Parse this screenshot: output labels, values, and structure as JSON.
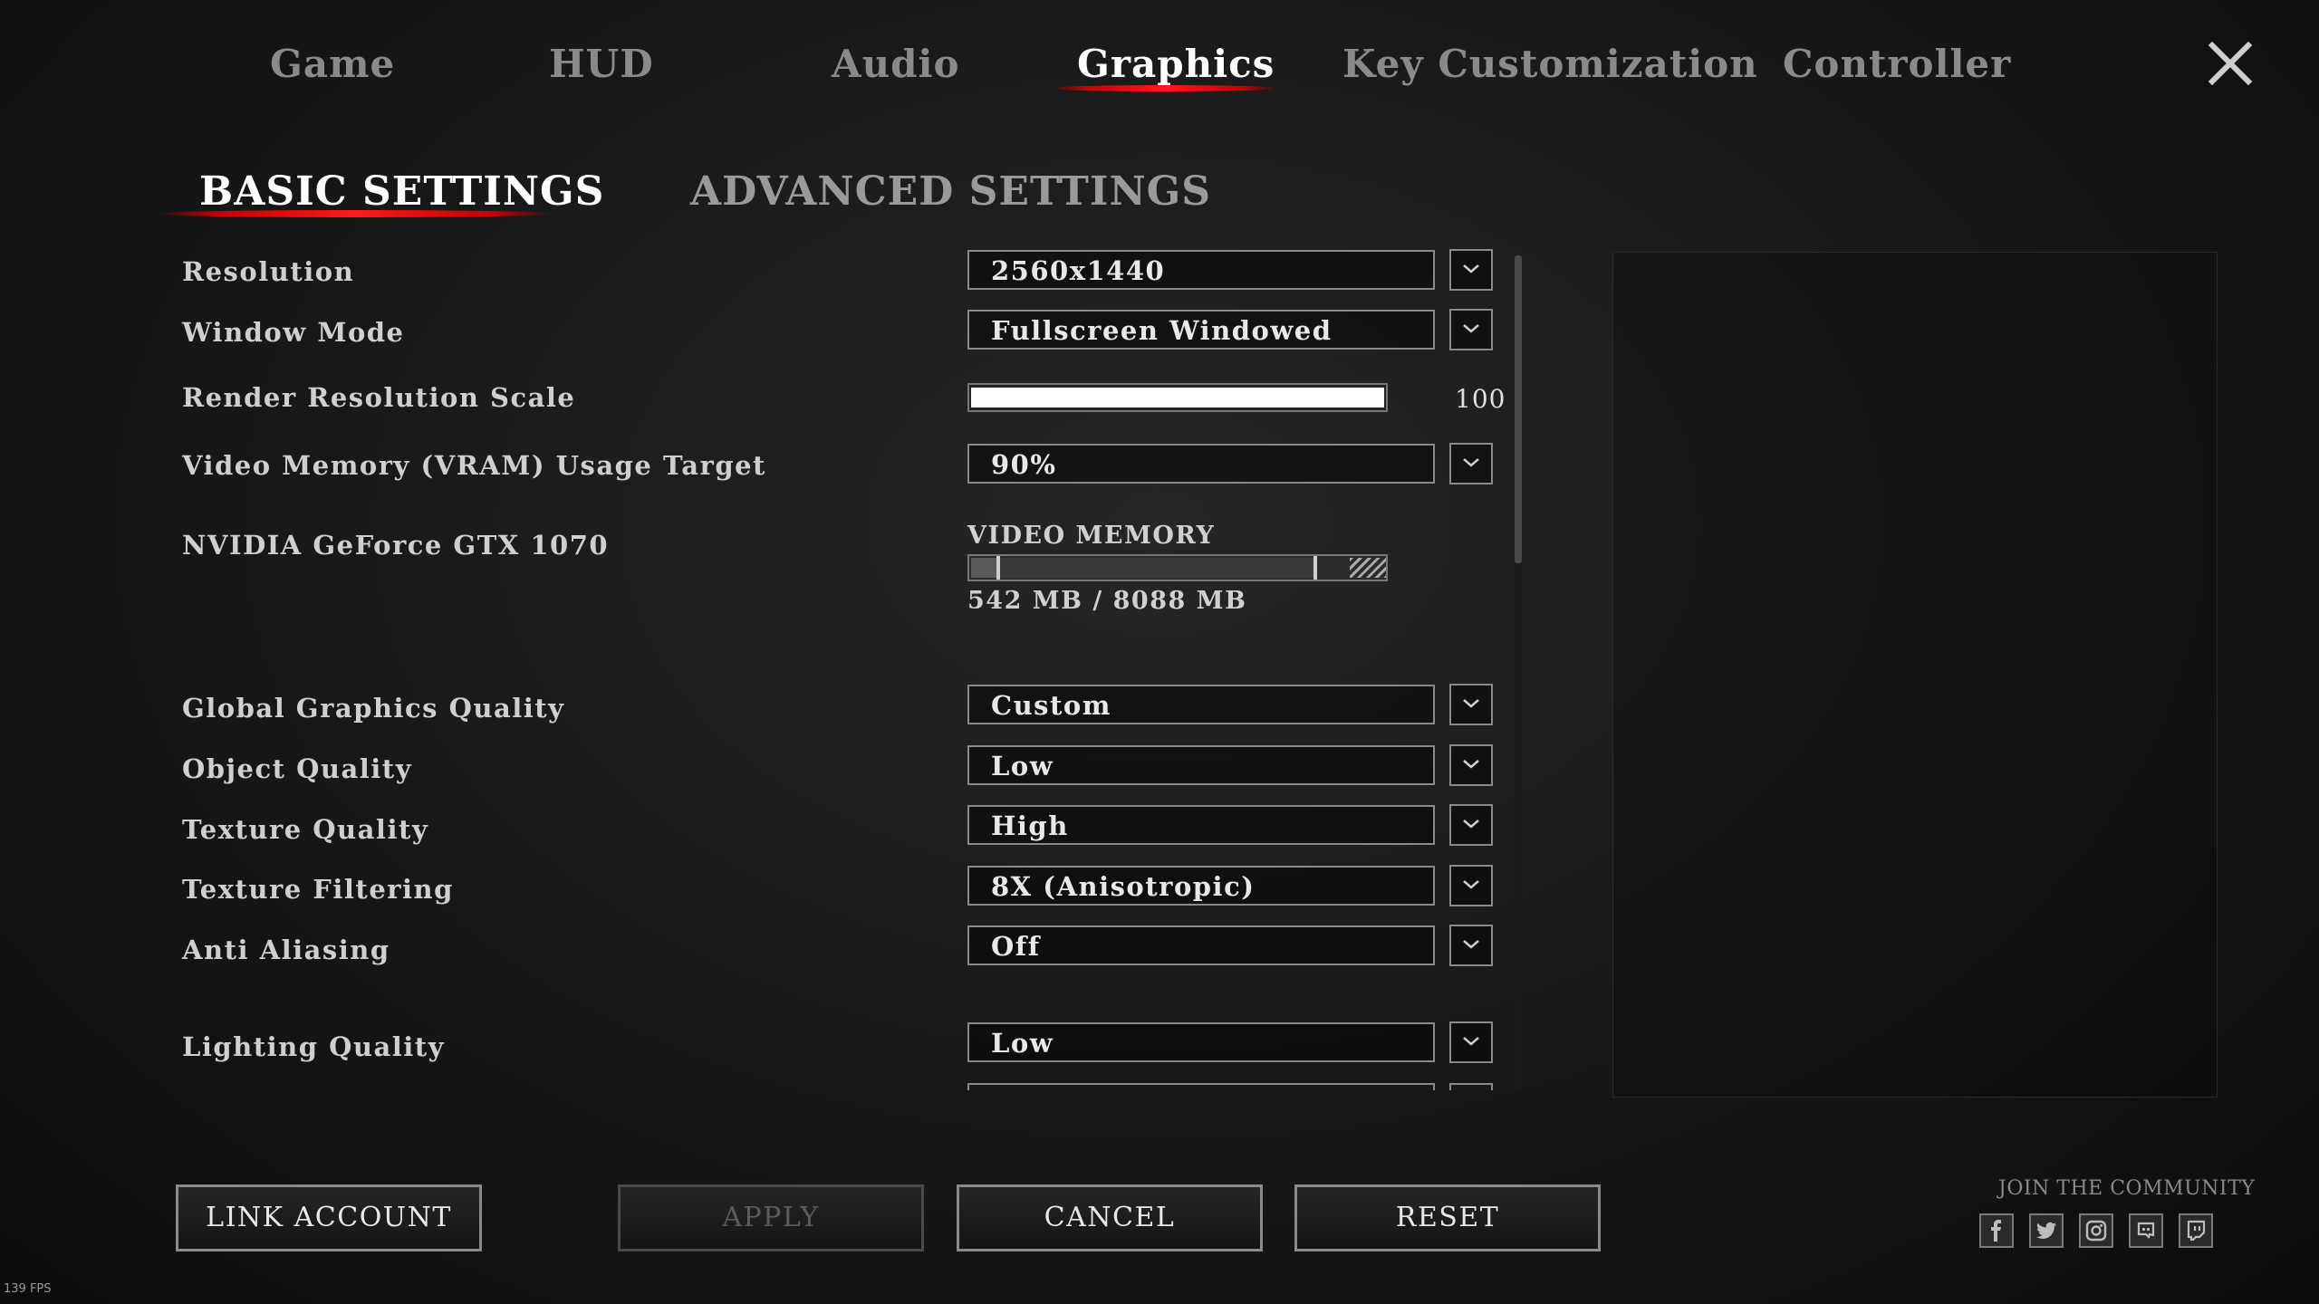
{
  "tabs": [
    {
      "label": "Game",
      "active": false
    },
    {
      "label": "HUD",
      "active": false
    },
    {
      "label": "Audio",
      "active": false
    },
    {
      "label": "Graphics",
      "active": true
    },
    {
      "label": "Key Customization",
      "active": false
    },
    {
      "label": "Controller",
      "active": false
    }
  ],
  "subtabs": [
    {
      "label": "BASIC SETTINGS",
      "active": true
    },
    {
      "label": "ADVANCED SETTINGS",
      "active": false
    }
  ],
  "settings": {
    "resolution": {
      "label": "Resolution",
      "value": "2560x1440"
    },
    "window_mode": {
      "label": "Window Mode",
      "value": "Fullscreen Windowed"
    },
    "render_scale": {
      "label": "Render Resolution Scale",
      "value": "100",
      "fill_fraction": 1.0
    },
    "vram_target": {
      "label": "Video Memory (VRAM) Usage Target",
      "value": "90%"
    },
    "gpu": {
      "label": "NVIDIA GeForce GTX 1070",
      "memory_label": "VIDEO MEMORY",
      "memory_text": "542 MB / 8088 MB",
      "used_mb": 542,
      "total_mb": 8088,
      "target_fraction": 0.9
    },
    "global_quality": {
      "label": "Global Graphics Quality",
      "value": "Custom"
    },
    "object_quality": {
      "label": "Object Quality",
      "value": "Low"
    },
    "texture_quality": {
      "label": "Texture Quality",
      "value": "High"
    },
    "texture_filtering": {
      "label": "Texture Filtering",
      "value": "8X (Anisotropic)"
    },
    "anti_aliasing": {
      "label": "Anti Aliasing",
      "value": "Off"
    },
    "lighting_quality": {
      "label": "Lighting Quality",
      "value": "Low"
    }
  },
  "buttons": {
    "link_account": "LINK ACCOUNT",
    "apply": "APPLY",
    "cancel": "CANCEL",
    "reset": "RESET"
  },
  "community": {
    "label": "JOIN THE COMMUNITY",
    "icons": [
      "facebook-icon",
      "twitter-icon",
      "instagram-icon",
      "discord-icon",
      "twitch-icon"
    ]
  },
  "fps": "139 FPS",
  "colors": {
    "accent_red": "#e01010",
    "active_text": "#ffffff",
    "inactive_text": "#8a8a8a"
  }
}
